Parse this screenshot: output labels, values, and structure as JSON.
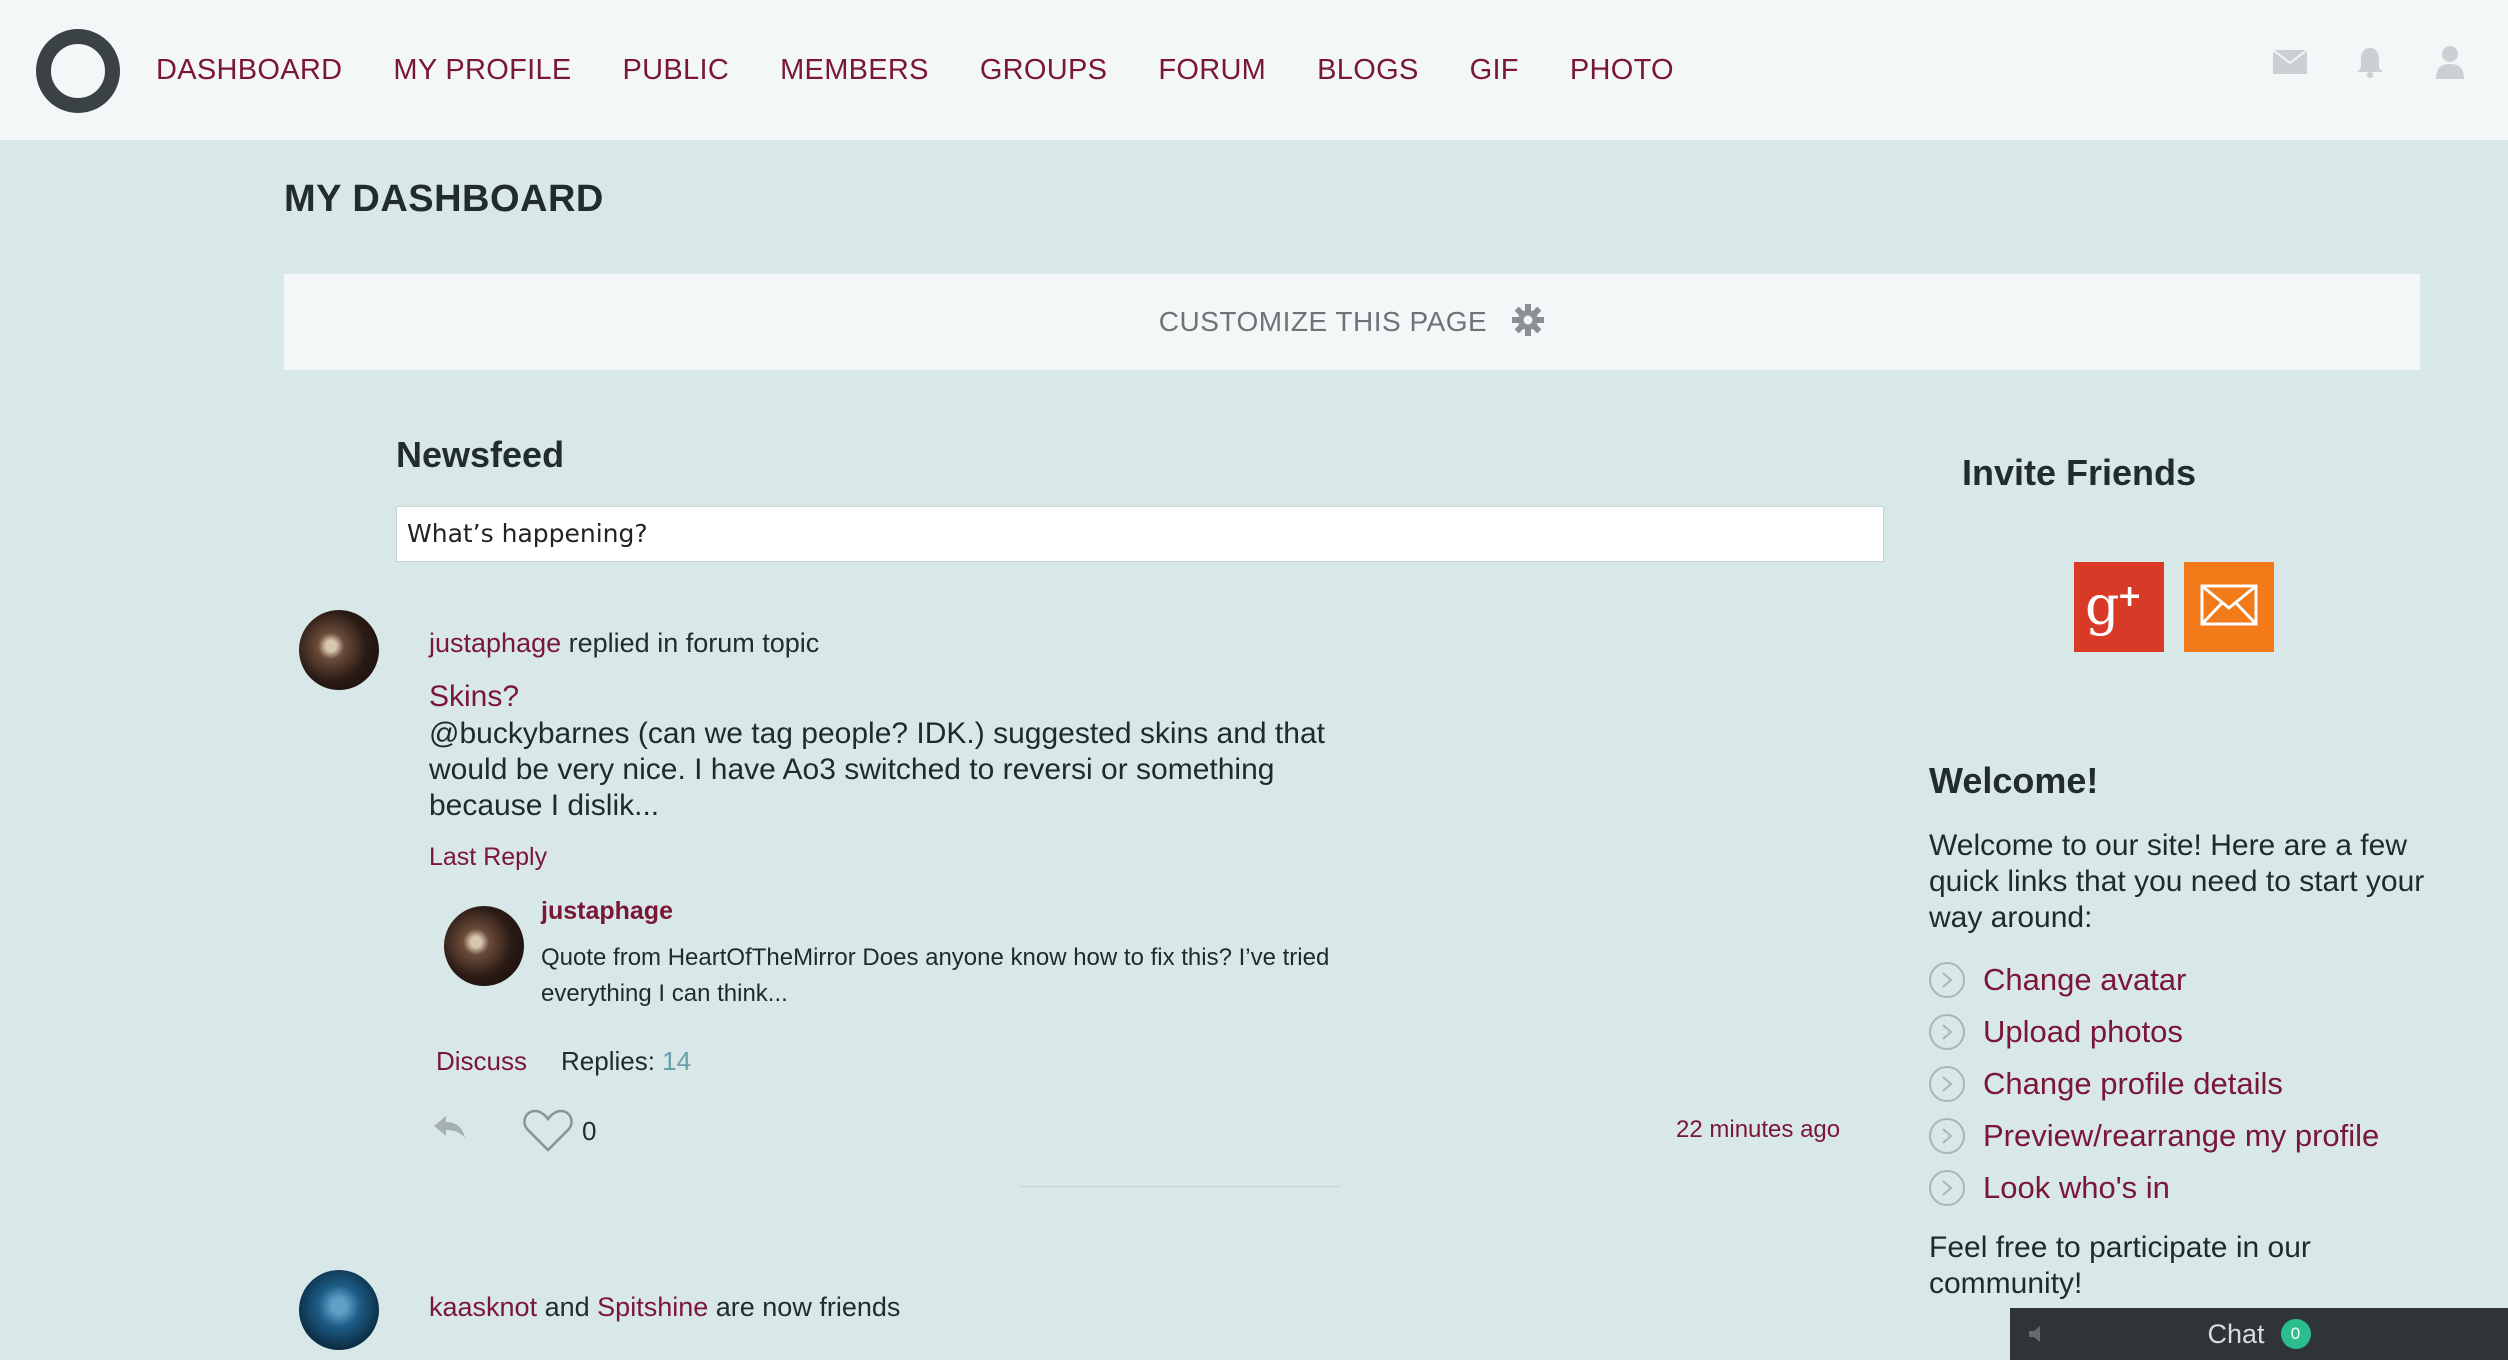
{
  "nav": {
    "items": [
      "DASHBOARD",
      "MY PROFILE",
      "PUBLIC",
      "MEMBERS",
      "GROUPS",
      "FORUM",
      "BLOGS",
      "GIF",
      "PHOTO"
    ],
    "icons": [
      "mail-icon",
      "bell-icon",
      "user-icon"
    ]
  },
  "page": {
    "title": "MY DASHBOARD",
    "customize_label": "CUSTOMIZE THIS PAGE"
  },
  "newsfeed": {
    "title": "Newsfeed",
    "input_value": "What’s happening?",
    "activities": [
      {
        "user": "justaphage",
        "action": "replied in forum topic",
        "topic": "Skins?",
        "excerpt": "@buckybarnes (can we tag people? IDK.) suggested skins and that would be very nice.  I have Ao3 switched to reversi or something because I dislik...",
        "last_reply_label": "Last Reply",
        "reply": {
          "user": "justaphage",
          "text": "Quote from HeartOfTheMirror Does anyone know how to fix this? I’ve tried everything I can think..."
        },
        "discuss_label": "Discuss",
        "replies_label": "Replies:",
        "replies_count": "14",
        "likes": "0",
        "time": "22 minutes ago"
      },
      {
        "user": "kaasknot",
        "connector": "and",
        "friend": "Spitshine",
        "action": "are now friends"
      }
    ]
  },
  "sidebar": {
    "invite_title": "Invite Friends",
    "welcome_title": "Welcome!",
    "welcome_text": "Welcome to our site! Here are a few quick links that you need to start your way around:",
    "quick_links": [
      "Change avatar",
      "Upload photos",
      "Change profile details",
      "Preview/rearrange my profile",
      "Look who's in"
    ],
    "participate_text": "Feel free to participate in our community!"
  },
  "chat": {
    "label": "Chat",
    "count": "0"
  },
  "colors": {
    "accent": "#7a1636",
    "background": "#d8e7e8",
    "google_plus": "#d83a27",
    "mail": "#f27a18",
    "chat_badge": "#2bbd8e"
  }
}
